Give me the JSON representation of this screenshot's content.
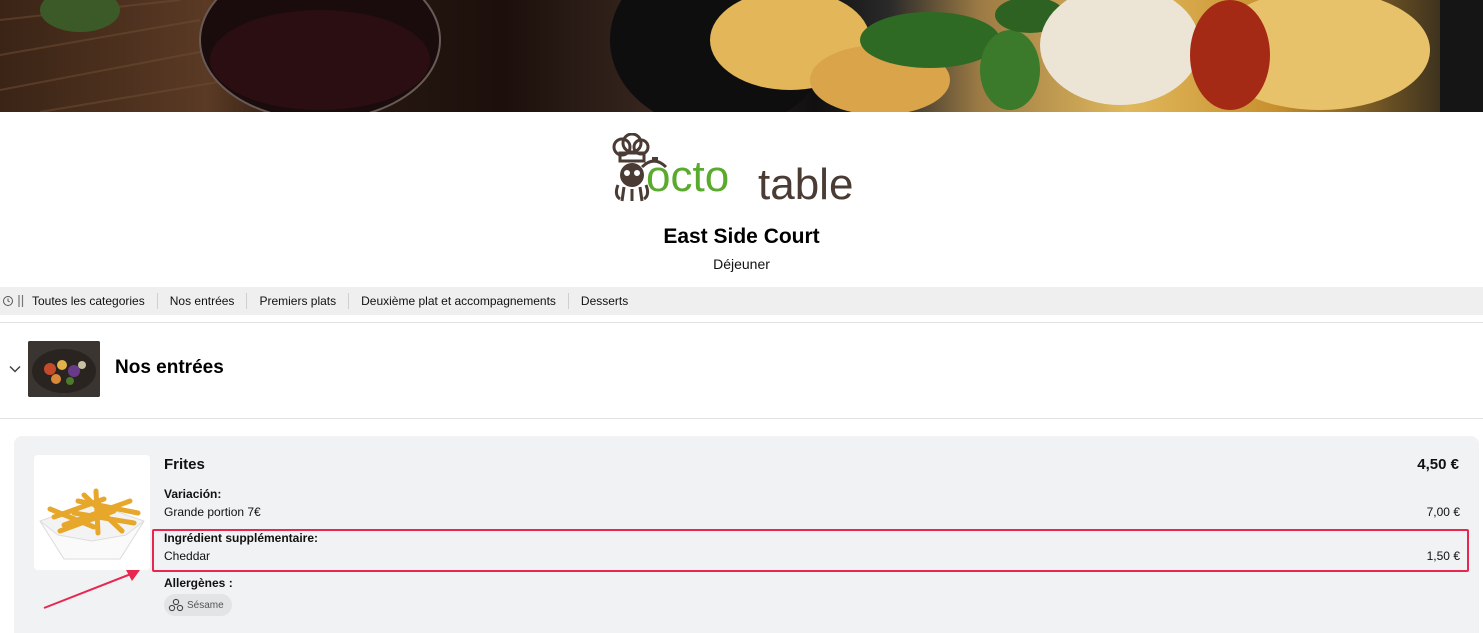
{
  "brand": {
    "logo_left": "octo",
    "logo_right": "table"
  },
  "restaurant": {
    "name": "East Side Court",
    "service": "Déjeuner"
  },
  "categories": {
    "items": [
      "Toutes les categories",
      "Nos entrées",
      "Premiers plats",
      "Deuxième plat et accompagnements",
      "Desserts"
    ]
  },
  "section": {
    "title": "Nos entrées"
  },
  "item": {
    "name": "Frites",
    "price": "4,50 €",
    "variation": {
      "label": "Variación:",
      "option": "Grande portion 7€",
      "price": "7,00 €"
    },
    "extra": {
      "label": "Ingrédient supplémentaire:",
      "option": "Cheddar",
      "price": "1,50 €"
    },
    "allergens": {
      "label": "Allergènes :",
      "items": [
        "Sésame"
      ]
    }
  },
  "colors": {
    "brand_green": "#5aaa2e",
    "brand_brown": "#4a3b35",
    "highlight": "#e8264f",
    "nav_bg": "#efefef",
    "card_bg": "#f1f2f4"
  }
}
